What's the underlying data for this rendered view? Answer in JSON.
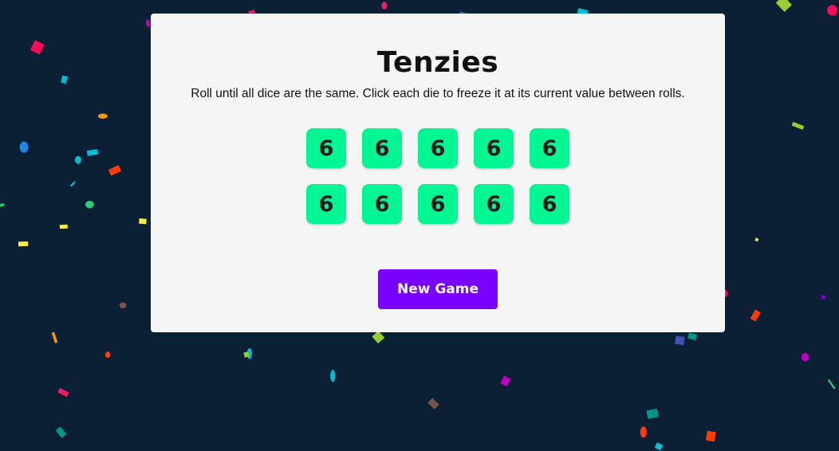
{
  "game": {
    "title": "Tenzies",
    "instructions": "Roll until all dice are the same. Click each die to freeze it at its current value between rolls.",
    "dice": [
      {
        "value": "6",
        "held": true
      },
      {
        "value": "6",
        "held": true
      },
      {
        "value": "6",
        "held": true
      },
      {
        "value": "6",
        "held": true
      },
      {
        "value": "6",
        "held": true
      },
      {
        "value": "6",
        "held": true
      },
      {
        "value": "6",
        "held": true
      },
      {
        "value": "6",
        "held": true
      },
      {
        "value": "6",
        "held": true
      },
      {
        "value": "6",
        "held": true
      }
    ],
    "button_label": "New Game",
    "won": true
  },
  "colors": {
    "background": "#0b2035",
    "card": "#f5f5f5",
    "die_held": "#00f593",
    "button": "#7a00ff"
  },
  "confetti_colors": [
    "#ff0a54",
    "#00bcd4",
    "#7b00d4",
    "#ffeb3b",
    "#9acd32",
    "#1e88e5",
    "#ff9800",
    "#009688",
    "#e91e63",
    "#795548",
    "#2ecc71",
    "#3f51b5",
    "#ff3d00",
    "#c000c0"
  ]
}
